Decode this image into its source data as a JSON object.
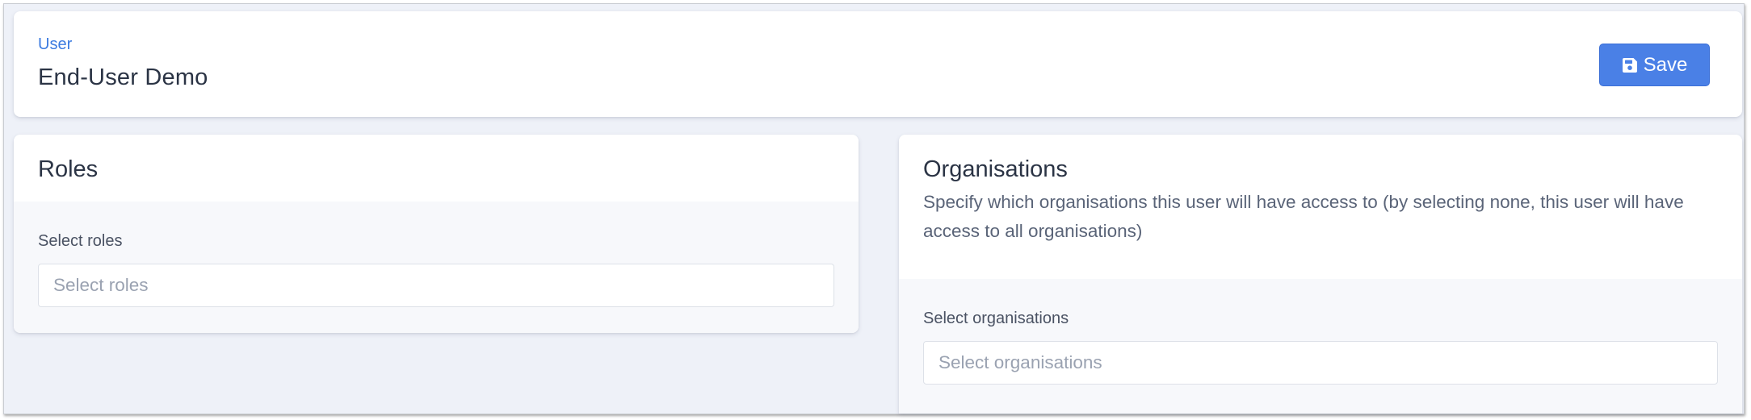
{
  "header": {
    "breadcrumb": "User",
    "title": "End-User Demo",
    "save_label": "Save"
  },
  "roles": {
    "title": "Roles",
    "field_label": "Select roles",
    "placeholder": "Select roles"
  },
  "organisations": {
    "title": "Organisations",
    "description": "Specify which organisations this user will have access to (by selecting none, this user will have access to all organisations)",
    "field_label": "Select organisations",
    "placeholder": "Select organisations"
  },
  "icons": {
    "save": "floppy-disk-icon"
  },
  "colors": {
    "accent": "#4a80e6",
    "breadcrumb": "#3c7be0",
    "background": "#eef1f8"
  }
}
